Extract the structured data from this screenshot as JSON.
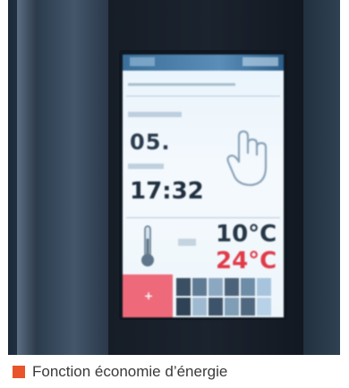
{
  "photo": {
    "screen": {
      "day_value": "05.",
      "time_value": "17:32",
      "temperature_low": "10°C",
      "temperature_high": "24°C",
      "icons": [
        "touch-hand-icon",
        "thermometer-icon"
      ]
    }
  },
  "caption": {
    "text": "Fonction économie d’énergie",
    "marker_color": "#e8552a"
  },
  "colors": {
    "high_temperature": "#e03a48",
    "action_button": "#ee6a7a"
  }
}
